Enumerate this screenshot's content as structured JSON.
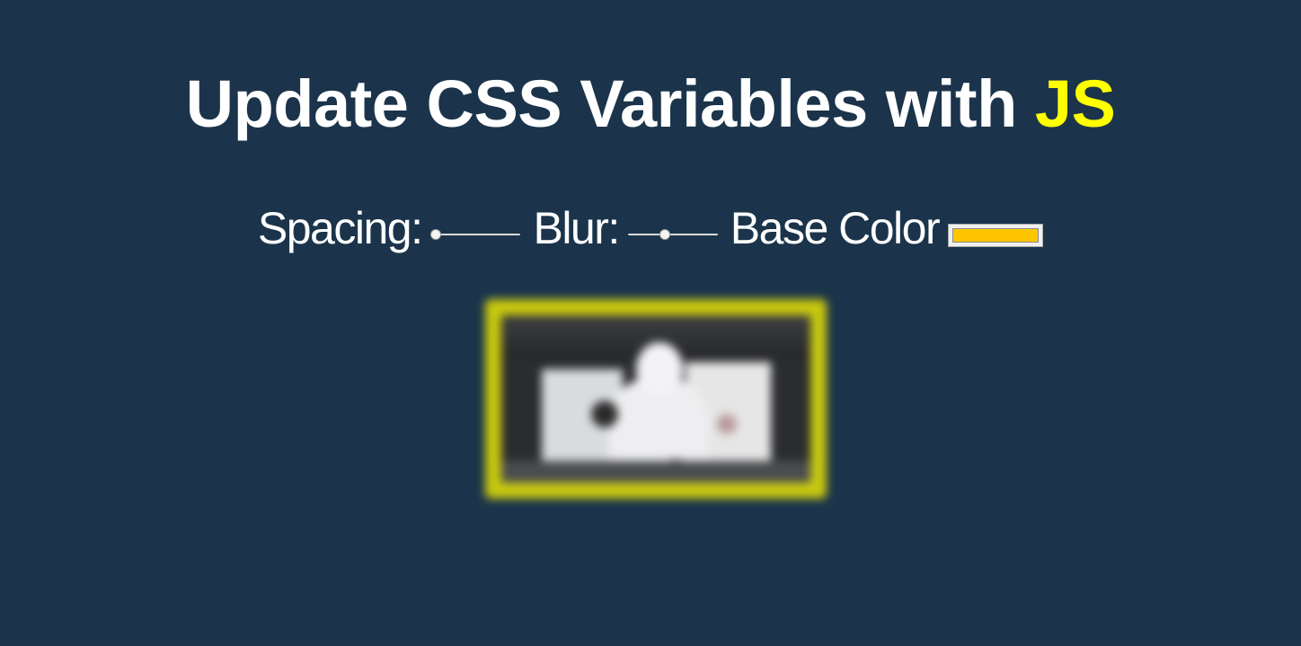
{
  "header": {
    "title_main": "Update CSS Variables with ",
    "title_accent": "JS",
    "accent_color": "#ffff00"
  },
  "controls": {
    "spacing": {
      "label": "Spacing:",
      "value": 0
    },
    "blur": {
      "label": "Blur:",
      "value": 0.4
    },
    "base_color": {
      "label": "Base Color",
      "value": "#ffc600"
    }
  },
  "colors": {
    "background": "#1b344b",
    "text": "#ffffff",
    "frame": "#c9c90f"
  },
  "icons": {
    "photo": "blurred-photo"
  }
}
